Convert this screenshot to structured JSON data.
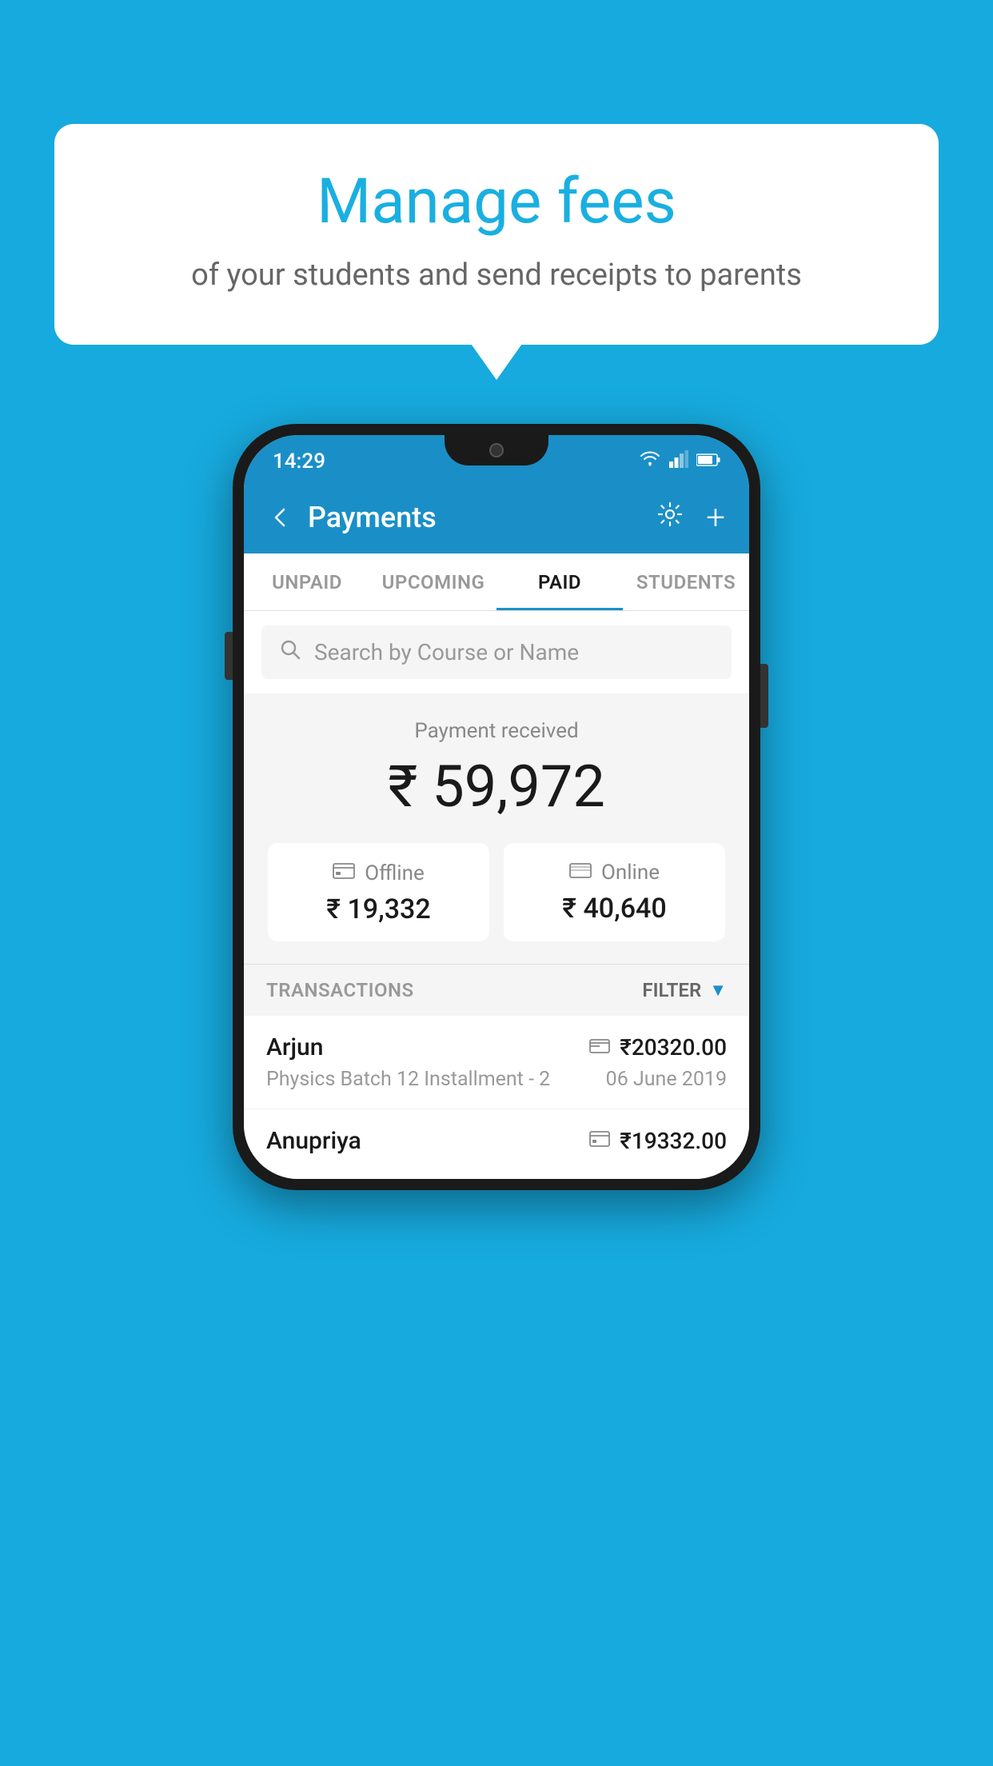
{
  "background_color": "#17AADE",
  "speech_bubble": {
    "title": "Manage fees",
    "subtitle": "of your students and send receipts to parents"
  },
  "phone": {
    "status_bar": {
      "time": "14:29",
      "icons": [
        "wifi",
        "signal",
        "battery"
      ]
    },
    "header": {
      "back_label": "←",
      "title": "Payments",
      "settings_icon": "gear",
      "add_icon": "+"
    },
    "tabs": [
      {
        "label": "UNPAID",
        "active": false
      },
      {
        "label": "UPCOMING",
        "active": false
      },
      {
        "label": "PAID",
        "active": true
      },
      {
        "label": "STUDENTS",
        "active": false
      }
    ],
    "search": {
      "placeholder": "Search by Course or Name"
    },
    "payment_summary": {
      "label": "Payment received",
      "total": "₹ 59,972",
      "offline": {
        "icon": "cash",
        "label": "Offline",
        "amount": "₹ 19,332"
      },
      "online": {
        "icon": "card",
        "label": "Online",
        "amount": "₹ 40,640"
      }
    },
    "transactions": {
      "header_label": "TRANSACTIONS",
      "filter_label": "FILTER",
      "items": [
        {
          "name": "Arjun",
          "description": "Physics Batch 12 Installment - 2",
          "amount": "₹20320.00",
          "date": "06 June 2019",
          "payment_type": "card"
        },
        {
          "name": "Anupriya",
          "description": "",
          "amount": "₹19332.00",
          "date": "",
          "payment_type": "cash"
        }
      ]
    }
  }
}
